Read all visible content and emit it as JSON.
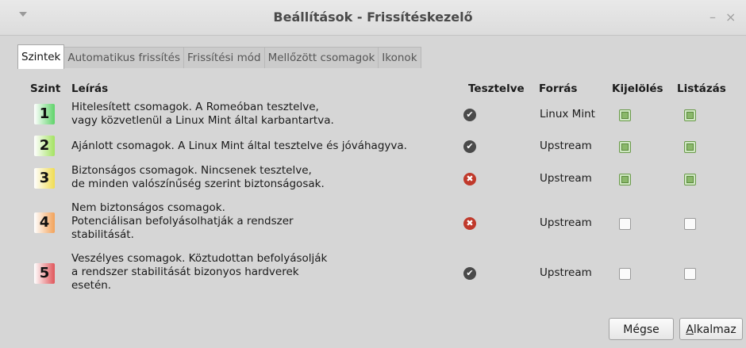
{
  "window": {
    "title": "Beállítások - Frissítéskezelő"
  },
  "tabs": [
    {
      "label": "Szintek"
    },
    {
      "label": "Automatikus frissítés"
    },
    {
      "label": "Frissítési mód"
    },
    {
      "label": "Mellőzött csomagok"
    },
    {
      "label": "Ikonok"
    }
  ],
  "table": {
    "headers": {
      "level": "Szint",
      "description": "Leírás",
      "tested": "Tesztelve",
      "origin": "Forrás",
      "selected": "Kijelölés",
      "listed": "Listázás"
    },
    "rows": [
      {
        "level": "1",
        "color": "#5fd36a",
        "description": "Hitelesített csomagok. A Romeóban tesztelve,\nvagy közvetlenül a Linux Mint által karbantartva.",
        "tested": "ok",
        "tested_icon": "checkmark-icon",
        "origin": "Linux Mint",
        "selected": true,
        "listed": true
      },
      {
        "level": "2",
        "color": "#a4e262",
        "description": "Ajánlott csomagok. A Linux Mint által tesztelve és jóváhagyva.",
        "tested": "ok",
        "tested_icon": "checkmark-icon",
        "origin": "Upstream",
        "selected": true,
        "listed": true
      },
      {
        "level": "3",
        "color": "#f0dc52",
        "description": "Biztonságos csomagok. Nincsenek tesztelve,\nde minden valószínűség szerint biztonságosak.",
        "tested": "bad",
        "tested_icon": "cross-icon",
        "origin": "Upstream",
        "selected": true,
        "listed": true
      },
      {
        "level": "4",
        "color": "#f2a25a",
        "description": "Nem biztonságos csomagok.\nPotenciálisan befolyásolhatják a rendszer\nstabilitását.",
        "tested": "bad",
        "tested_icon": "cross-icon",
        "origin": "Upstream",
        "selected": false,
        "listed": false
      },
      {
        "level": "5",
        "color": "#e0565b",
        "description": "Veszélyes csomagok. Köztudottan befolyásolják\na rendszer stabilitását bizonyos hardverek\nesetén.",
        "tested": "ok",
        "tested_icon": "checkmark-icon",
        "origin": "Upstream",
        "selected": false,
        "listed": false
      }
    ]
  },
  "buttons": {
    "cancel": "Mégse",
    "apply_mnemonic": "A",
    "apply_rest": "lkalmaz"
  },
  "icons": {
    "status_ok": "✔",
    "status_bad": "✖",
    "minimize": "–",
    "close": "×"
  }
}
